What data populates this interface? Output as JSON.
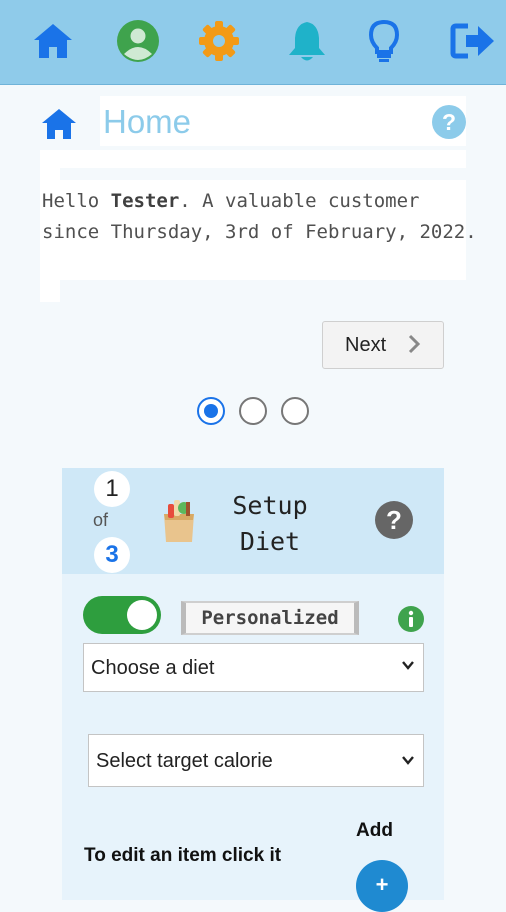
{
  "toolbar": {
    "icons": [
      "home-icon",
      "user-icon",
      "gear-icon",
      "bell-icon",
      "lightbulb-icon",
      "logout-icon"
    ],
    "colors": {
      "bar": "#8fcbea",
      "primary": "#1a73e8",
      "user": "#3fa34d",
      "gear": "#f39a16",
      "bell": "#1fb2c9"
    }
  },
  "page": {
    "title": "Home",
    "greeting_prefix": "Hello ",
    "user_name": "Tester",
    "greeting_suffix": ". A valuable customer since Thursday, 3rd of February, 2022."
  },
  "pager": {
    "next_label": "Next",
    "dots_total": 3,
    "active_dot": 1
  },
  "setup_card": {
    "step_current": "1",
    "step_of": "of",
    "step_total": "3",
    "title_line1": "Setup",
    "title_line2": "Diet",
    "toggle_on": true,
    "mode_badge": "Personalized",
    "diet_select": {
      "value": "Choose a diet"
    },
    "calorie_select": {
      "value": "Select target calorie"
    },
    "edit_hint": "To edit an item click it",
    "add_label": "Add",
    "add_button": "+"
  }
}
